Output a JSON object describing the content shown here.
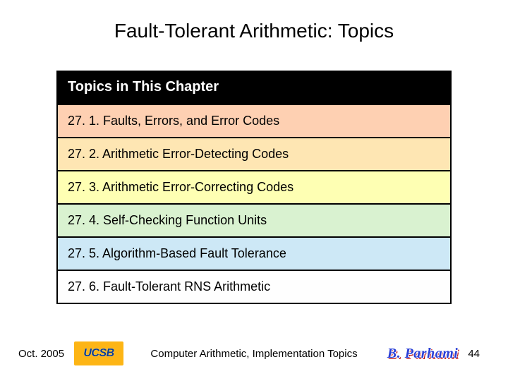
{
  "title": "Fault-Tolerant Arithmetic: Topics",
  "table": {
    "header": "Topics in This Chapter",
    "rows": [
      "27. 1.  Faults, Errors, and Error Codes",
      "27. 2.  Arithmetic Error-Detecting Codes",
      "27. 3.  Arithmetic Error-Correcting Codes",
      "27. 4.  Self-Checking Function Units",
      "27. 5.  Algorithm-Based Fault Tolerance",
      "27. 6.  Fault-Tolerant RNS Arithmetic"
    ]
  },
  "footer": {
    "date": "Oct. 2005",
    "ucsb": "UCSB",
    "caption": "Computer Arithmetic, Implementation Topics",
    "author": "B. Parhami",
    "page": "44"
  }
}
